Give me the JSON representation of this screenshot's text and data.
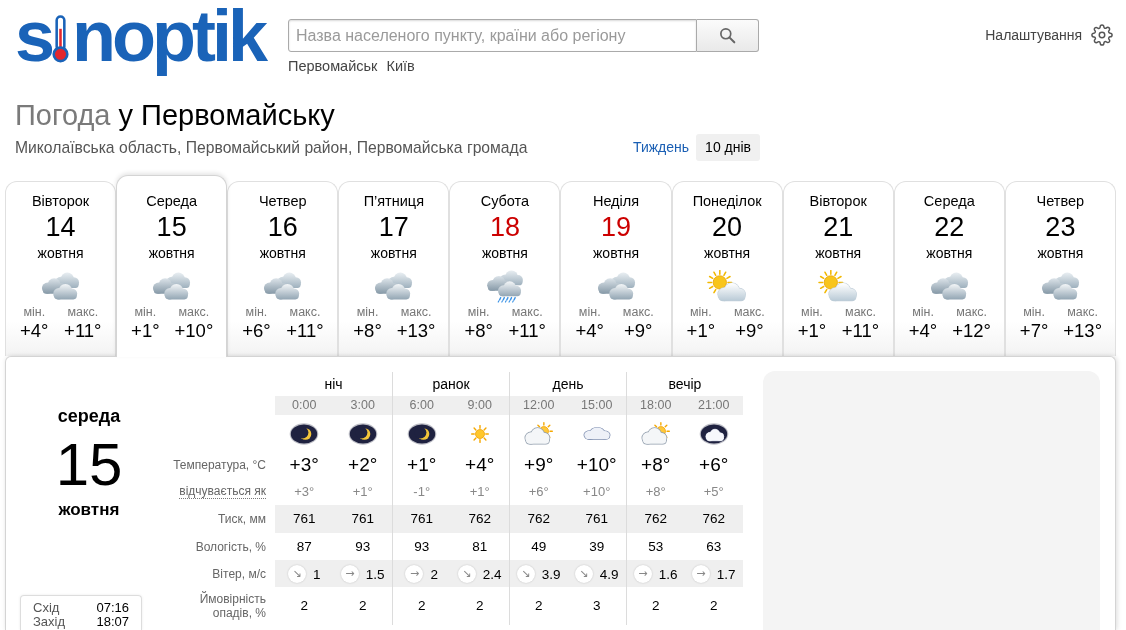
{
  "header": {
    "logo": {
      "start": "s",
      "end": "noptik"
    },
    "search": {
      "placeholder": "Назва населеного пункту, країни або регіону"
    },
    "quick_links": [
      "Первомайськ",
      "Київ"
    ],
    "settings": "Налаштування"
  },
  "heading": {
    "lead": "Погода",
    "place": "у Первомайську",
    "region": "Миколаївська область, Первомайський район, Первомайська громада"
  },
  "range_tabs": [
    {
      "label": "Тиждень",
      "selected": false
    },
    {
      "label": "10 днів",
      "selected": true
    }
  ],
  "days": [
    {
      "weekday": "Вівторок",
      "date": "14",
      "month": "жовтня",
      "weekend": false,
      "kind": "overcast",
      "min_label": "мін.",
      "min": "+4°",
      "max_label": "макс.",
      "max": "+11°",
      "selected": false
    },
    {
      "weekday": "Середа",
      "date": "15",
      "month": "жовтня",
      "weekend": false,
      "kind": "overcast",
      "min_label": "мін.",
      "min": "+1°",
      "max_label": "макс.",
      "max": "+10°",
      "selected": true
    },
    {
      "weekday": "Четвер",
      "date": "16",
      "month": "жовтня",
      "weekend": false,
      "kind": "overcast",
      "min_label": "мін.",
      "min": "+6°",
      "max_label": "макс.",
      "max": "+11°",
      "selected": false
    },
    {
      "weekday": "П’ятниця",
      "date": "17",
      "month": "жовтня",
      "weekend": false,
      "kind": "overcast",
      "min_label": "мін.",
      "min": "+8°",
      "max_label": "макс.",
      "max": "+13°",
      "selected": false
    },
    {
      "weekday": "Субота",
      "date": "18",
      "month": "жовтня",
      "weekend": true,
      "kind": "rain",
      "min_label": "мін.",
      "min": "+8°",
      "max_label": "макс.",
      "max": "+11°",
      "selected": false
    },
    {
      "weekday": "Неділя",
      "date": "19",
      "month": "жовтня",
      "weekend": true,
      "kind": "overcast",
      "min_label": "мін.",
      "min": "+4°",
      "max_label": "макс.",
      "max": "+9°",
      "selected": false
    },
    {
      "weekday": "Понеділок",
      "date": "20",
      "month": "жовтня",
      "weekend": false,
      "kind": "sun_cloud",
      "min_label": "мін.",
      "min": "+1°",
      "max_label": "макс.",
      "max": "+9°",
      "selected": false
    },
    {
      "weekday": "Вівторок",
      "date": "21",
      "month": "жовтня",
      "weekend": false,
      "kind": "sun_cloud",
      "min_label": "мін.",
      "min": "+1°",
      "max_label": "макс.",
      "max": "+11°",
      "selected": false
    },
    {
      "weekday": "Середа",
      "date": "22",
      "month": "жовтня",
      "weekend": false,
      "kind": "overcast",
      "min_label": "мін.",
      "min": "+4°",
      "max_label": "макс.",
      "max": "+12°",
      "selected": false
    },
    {
      "weekday": "Четвер",
      "date": "23",
      "month": "жовтня",
      "weekend": false,
      "kind": "overcast",
      "min_label": "мін.",
      "min": "+7°",
      "max_label": "макс.",
      "max": "+13°",
      "selected": false
    }
  ],
  "detail": {
    "weekday": "середа",
    "date": "15",
    "month": "жовтня",
    "sun_times": [
      {
        "label": "Схід",
        "time": "07:16"
      },
      {
        "label": "Захід",
        "time": "18:07"
      }
    ]
  },
  "hourly": {
    "periods": [
      "ніч",
      "ранок",
      "день",
      "вечір"
    ],
    "labels": {
      "temperature": "Температура, °C",
      "feels_like": "відчувається як",
      "pressure": "Тиск, мм",
      "humidity": "Вологість, %",
      "wind": "Вітер, м/с",
      "precipitation": "Ймовірність опадів, %"
    },
    "hours": [
      {
        "time": "0:00",
        "kind": "moon",
        "temp": "+3°",
        "feels": "+3°",
        "pressure": "761",
        "humidity": "87",
        "wind_arrow": "↘",
        "wind": "1",
        "precip": "2"
      },
      {
        "time": "3:00",
        "kind": "moon",
        "temp": "+2°",
        "feels": "+1°",
        "pressure": "761",
        "humidity": "93",
        "wind_arrow": "→",
        "wind": "1.5",
        "precip": "2"
      },
      {
        "time": "6:00",
        "kind": "moon",
        "temp": "+1°",
        "feels": "-1°",
        "pressure": "761",
        "humidity": "93",
        "wind_arrow": "→",
        "wind": "2",
        "precip": "2"
      },
      {
        "time": "9:00",
        "kind": "sun",
        "temp": "+4°",
        "feels": "+1°",
        "pressure": "762",
        "humidity": "81",
        "wind_arrow": "↘",
        "wind": "2.4",
        "precip": "2"
      },
      {
        "time": "12:00",
        "kind": "sun_cloud",
        "temp": "+9°",
        "feels": "+6°",
        "pressure": "762",
        "humidity": "49",
        "wind_arrow": "↘",
        "wind": "3.9",
        "precip": "2"
      },
      {
        "time": "15:00",
        "kind": "cloud",
        "temp": "+10°",
        "feels": "+10°",
        "pressure": "761",
        "humidity": "39",
        "wind_arrow": "↘",
        "wind": "4.9",
        "precip": "3"
      },
      {
        "time": "18:00",
        "kind": "sun_cloud",
        "temp": "+8°",
        "feels": "+8°",
        "pressure": "762",
        "humidity": "53",
        "wind_arrow": "→",
        "wind": "1.6",
        "precip": "2"
      },
      {
        "time": "21:00",
        "kind": "night_cloud",
        "temp": "+6°",
        "feels": "+5°",
        "pressure": "762",
        "humidity": "63",
        "wind_arrow": "→",
        "wind": "1.7",
        "precip": "2"
      }
    ]
  }
}
